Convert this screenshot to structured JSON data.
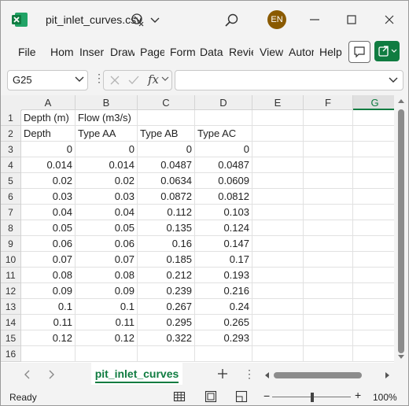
{
  "titlebar": {
    "filename": "pit_inlet_curves.csv",
    "avatar_initials": "EN"
  },
  "menu": {
    "items": [
      "File",
      "Hom",
      "Inser",
      "Draw",
      "Page",
      "Form",
      "Data",
      "Revie",
      "View",
      "Autor",
      "Help"
    ]
  },
  "formula_bar": {
    "name_box": "G25",
    "formula": "",
    "fx": "fx"
  },
  "grid": {
    "columns": [
      "A",
      "B",
      "C",
      "D",
      "E",
      "F",
      "G"
    ],
    "selected_column": "G",
    "rows": [
      "1",
      "2",
      "3",
      "4",
      "5",
      "6",
      "7",
      "8",
      "9",
      "10",
      "11",
      "12",
      "13",
      "14",
      "15",
      "16"
    ],
    "cells": [
      [
        "Depth (m)",
        "Flow (m3/s)",
        "",
        ""
      ],
      [
        "Depth",
        "Type AA",
        "Type AB",
        "Type AC"
      ],
      [
        "0",
        "0",
        "0",
        "0"
      ],
      [
        "0.014",
        "0.014",
        "0.0487",
        "0.0487"
      ],
      [
        "0.02",
        "0.02",
        "0.0634",
        "0.0609"
      ],
      [
        "0.03",
        "0.03",
        "0.0872",
        "0.0812"
      ],
      [
        "0.04",
        "0.04",
        "0.112",
        "0.103"
      ],
      [
        "0.05",
        "0.05",
        "0.135",
        "0.124"
      ],
      [
        "0.06",
        "0.06",
        "0.16",
        "0.147"
      ],
      [
        "0.07",
        "0.07",
        "0.185",
        "0.17"
      ],
      [
        "0.08",
        "0.08",
        "0.212",
        "0.193"
      ],
      [
        "0.09",
        "0.09",
        "0.239",
        "0.216"
      ],
      [
        "0.1",
        "0.1",
        "0.267",
        "0.24"
      ],
      [
        "0.11",
        "0.11",
        "0.295",
        "0.265"
      ],
      [
        "0.12",
        "0.12",
        "0.322",
        "0.293"
      ],
      [
        "",
        "",
        "",
        ""
      ]
    ]
  },
  "sheets": {
    "active": "pit_inlet_curves"
  },
  "status": {
    "text": "Ready",
    "zoom": "100%"
  },
  "colors": {
    "accent": "#107c41",
    "avatar": "#8a5a00"
  }
}
